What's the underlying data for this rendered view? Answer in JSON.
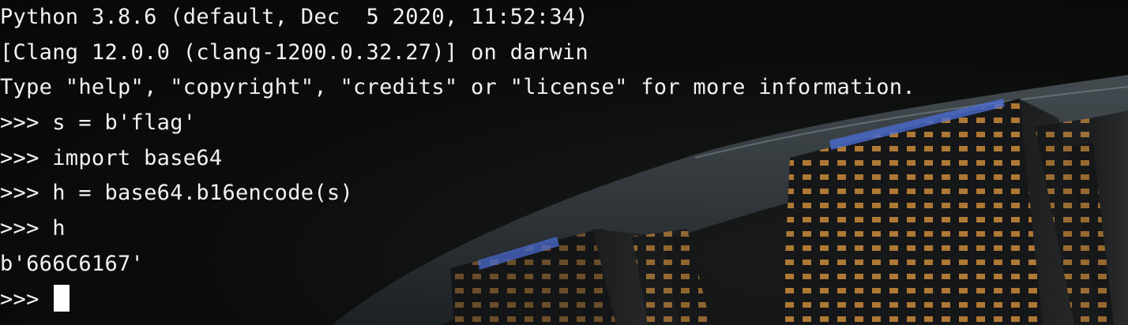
{
  "terminal": {
    "background_image": "night-skyline-hotel-photo",
    "lines": [
      "Python 3.8.6 (default, Dec  5 2020, 11:52:34)",
      "[Clang 12.0.0 (clang-1200.0.32.27)] on darwin",
      "Type \"help\", \"copyright\", \"credits\" or \"license\" for more information.",
      ">>> s = b'flag'",
      ">>> import base64",
      ">>> h = base64.b16encode(s)",
      ">>> h",
      "b'666C6167'"
    ],
    "prompt": ">>> ",
    "text_color": "#f2f2f2",
    "cursor_color": "#ffffff"
  }
}
